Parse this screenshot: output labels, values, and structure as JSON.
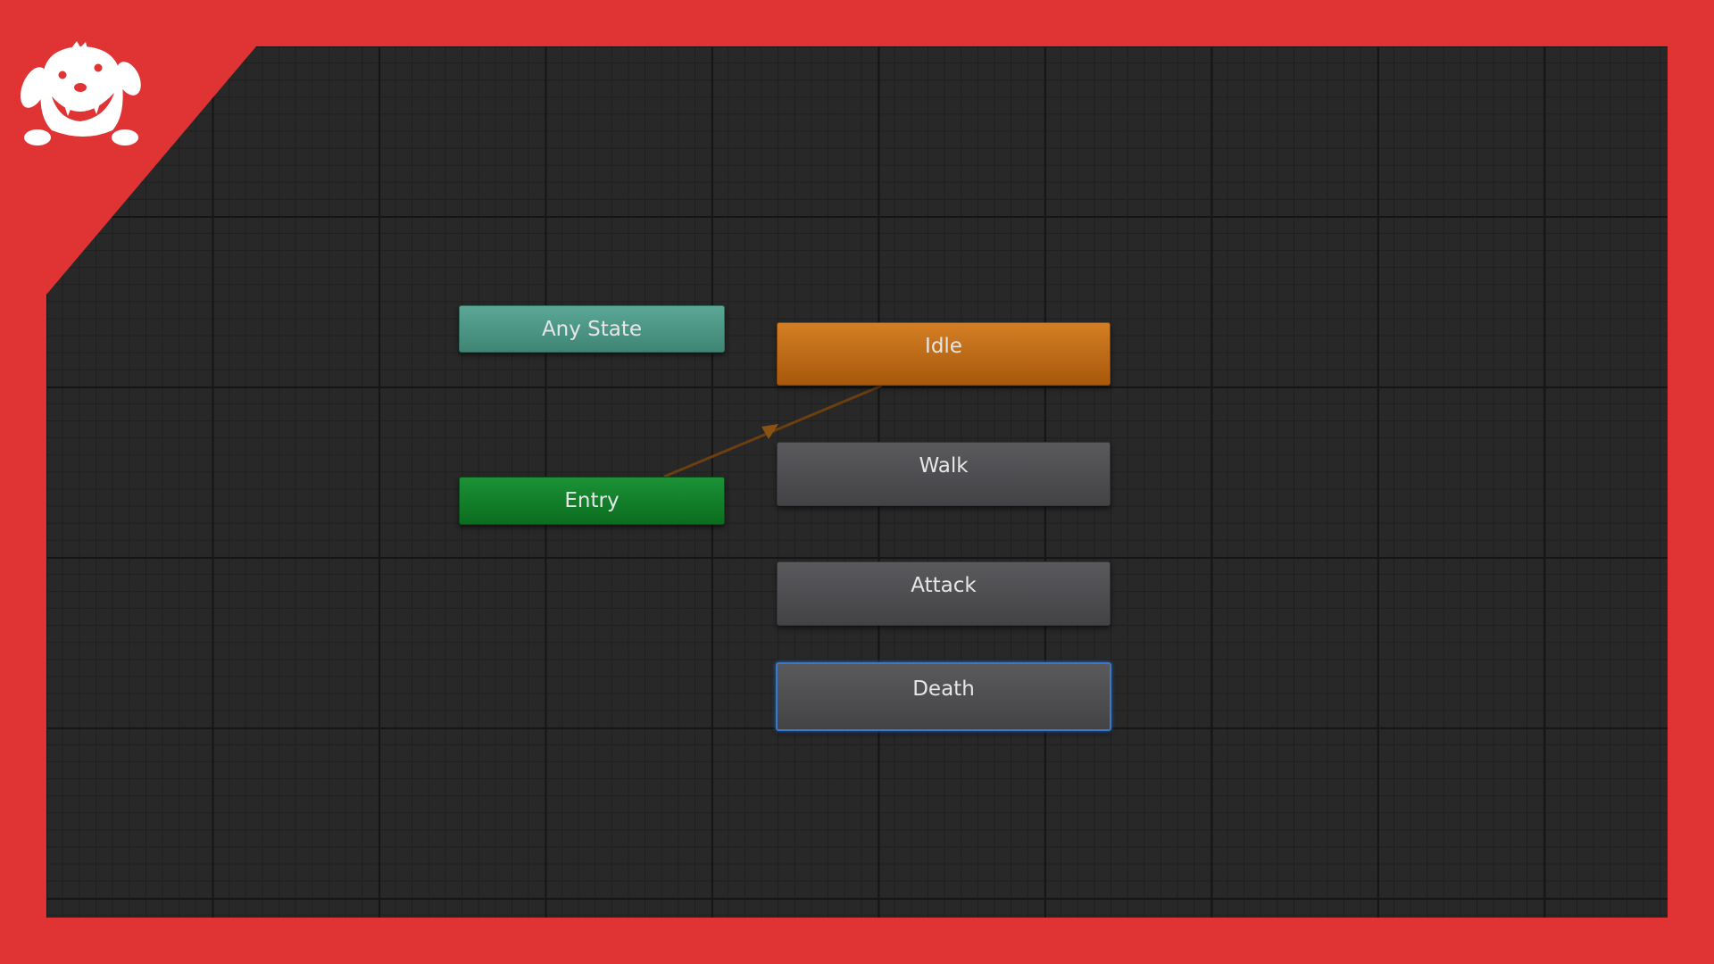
{
  "theme": {
    "frame_color": "#e03434",
    "canvas_color": "#282828",
    "transition_color": "#6b3f10",
    "selection_color": "#3a78c8"
  },
  "logo": {
    "icon": "dog-mascot-icon"
  },
  "states": {
    "any_state": {
      "label": "Any State",
      "color": "#4f9a88"
    },
    "entry": {
      "label": "Entry",
      "color": "#14822c"
    },
    "idle": {
      "label": "Idle",
      "color": "#c06c18",
      "is_default": true
    },
    "walk": {
      "label": "Walk",
      "color": "#4f4f52"
    },
    "attack": {
      "label": "Attack",
      "color": "#4f4f52"
    },
    "death": {
      "label": "Death",
      "color": "#4f4f52",
      "selected": true
    }
  },
  "transitions": [
    {
      "from": "Entry",
      "to": "Idle"
    }
  ]
}
